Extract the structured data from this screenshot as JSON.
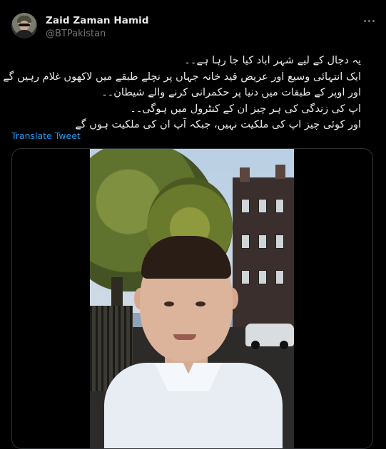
{
  "tweet": {
    "author_name": "Zaid Zaman Hamid",
    "author_handle": "@BTPakistan",
    "text_lines": [
      "یہ دجال کے لیے شہر اباد کیا جا رہا ہے۔۔",
      "ایک انتہائی وسیع اور عریض قید خانہ جہاں پر نچلے طبقے میں لاکھوں غلام رہیں گے",
      "اور اوپر کے طبقات میں دنیا پر حکمرانی کرنے والے شیطان۔۔",
      "اپ کی زندگی کی ہر چیز ان کے کنٹرول میں ہوگی۔۔",
      "اور کوئی چیز اپ کی ملکیت نہیں، جبکہ آپ ان کی ملکیت ہوں گے"
    ],
    "translate_label": "Translate Tweet"
  },
  "icons": {
    "more": "more-options-icon"
  },
  "colors": {
    "background": "#000000",
    "text": "#e7e9ea",
    "secondary": "#71767b",
    "link": "#1d9bf0",
    "border": "#2f3336"
  }
}
